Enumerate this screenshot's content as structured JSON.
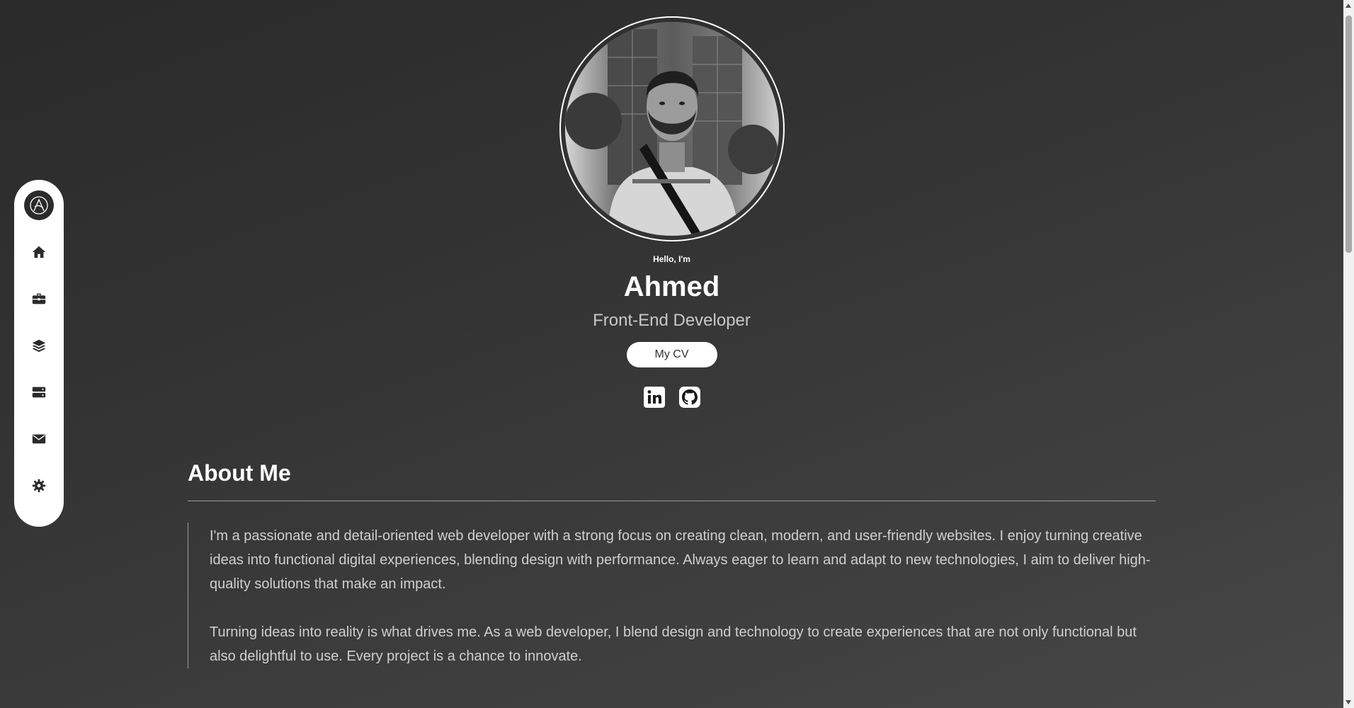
{
  "sidebar": {
    "items": [
      {
        "icon": "home-icon"
      },
      {
        "icon": "briefcase-icon"
      },
      {
        "icon": "layers-icon"
      },
      {
        "icon": "server-icon"
      },
      {
        "icon": "envelope-icon"
      },
      {
        "icon": "gear-icon"
      }
    ]
  },
  "hero": {
    "greeting": "Hello, I'm",
    "name": "Ahmed",
    "role": "Front-End Developer",
    "cv_label": "My CV",
    "socials": [
      {
        "icon": "linkedin-icon"
      },
      {
        "icon": "github-icon"
      }
    ]
  },
  "about": {
    "title": "About Me",
    "paragraphs": [
      "I'm a passionate and detail-oriented web developer with a strong focus on creating clean, modern, and user-friendly websites. I enjoy turning creative ideas into functional digital experiences, blending design with performance. Always eager to learn and adapt to new technologies, I aim to deliver high-quality solutions that make an impact.",
      "Turning ideas into reality is what drives me. As a web developer, I blend design and technology to create experiences that are not only functional but also delightful to use. Every project is a chance to innovate."
    ]
  },
  "colors": {
    "background_dark": "#2a2a2a",
    "background_light": "#474747",
    "sidebar": "#ffffff",
    "text_muted": "#cfcfcf"
  }
}
